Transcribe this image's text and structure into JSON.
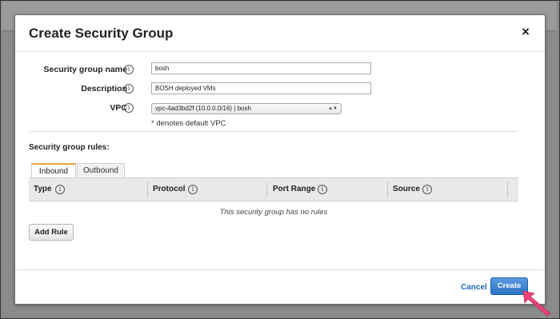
{
  "dialog": {
    "title": "Create Security Group",
    "close_glyph": "×"
  },
  "form": {
    "name_label": "Security group name",
    "name_value": "bosh",
    "description_label": "Description",
    "description_value": "BOSH deployed VMs",
    "vpc_label": "VPC",
    "vpc_selected": "vpc-4ad3bd2f (10.0.0.0/16) | bosh",
    "vpc_note": "* denotes default VPC",
    "info_glyph": "i"
  },
  "rules": {
    "heading": "Security group rules:",
    "tabs": [
      {
        "label": "Inbound",
        "active": true
      },
      {
        "label": "Outbound",
        "active": false
      }
    ],
    "columns": [
      "Type",
      "Protocol",
      "Port Range",
      "Source"
    ],
    "empty_message": "This security group has no rules",
    "add_rule_label": "Add Rule"
  },
  "footer": {
    "cancel_label": "Cancel",
    "create_label": "Create"
  },
  "colors": {
    "primary_button": "#2d73c7",
    "link": "#1f6ab8",
    "active_tab_accent": "#e8a23a",
    "pointer_arrow": "#e8437a"
  },
  "icons": {
    "close": "close-icon",
    "info": "info-icon",
    "dropdown": "chevron-down-icon",
    "annotation": "pointer-arrow-icon"
  }
}
